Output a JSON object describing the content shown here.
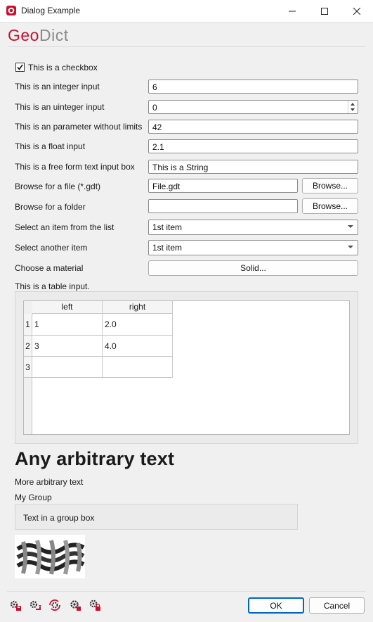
{
  "window": {
    "title": "Dialog Example"
  },
  "logo": {
    "part1": "Geo",
    "part2": "Dict"
  },
  "checkbox": {
    "label": "This is a checkbox",
    "checked": true
  },
  "fields": {
    "integer": {
      "label": "This is an integer input",
      "value": "6"
    },
    "uinteger": {
      "label": "This is an uinteger input",
      "value": "0"
    },
    "param": {
      "label": "This is an parameter without limits",
      "value": "42"
    },
    "float": {
      "label": "This is a float input",
      "value": "2.1"
    },
    "text": {
      "label": "This is a free form text input box",
      "value": "This is a String"
    },
    "file": {
      "label": "Browse for a file (*.gdt)",
      "value": "File.gdt",
      "button": "Browse..."
    },
    "folder": {
      "label": "Browse for a folder",
      "value": "",
      "button": "Browse..."
    },
    "list1": {
      "label": "Select an item from the list",
      "value": "1st item"
    },
    "list2": {
      "label": "Select another item",
      "value": "1st item"
    },
    "material": {
      "label": "Choose a material",
      "button": "Solid..."
    }
  },
  "table": {
    "label": "This is a table input.",
    "columns": [
      "left",
      "right"
    ],
    "rows": [
      {
        "num": "1",
        "left": "1",
        "right": "2.0"
      },
      {
        "num": "2",
        "left": "3",
        "right": "4.0"
      },
      {
        "num": "3",
        "left": "",
        "right": ""
      }
    ]
  },
  "text": {
    "big": "Any arbitrary text",
    "small": "More arbitrary text"
  },
  "group": {
    "title": "My Group",
    "content": "Text in a group box"
  },
  "footer": {
    "ok": "OK",
    "cancel": "Cancel",
    "icons": [
      "load-settings-icon",
      "save-settings-icon",
      "reset-settings-icon",
      "settings-macro-icon",
      "settings-lock-icon"
    ]
  },
  "colors": {
    "accent": "#c8102e",
    "ok_border": "#0067c0"
  }
}
